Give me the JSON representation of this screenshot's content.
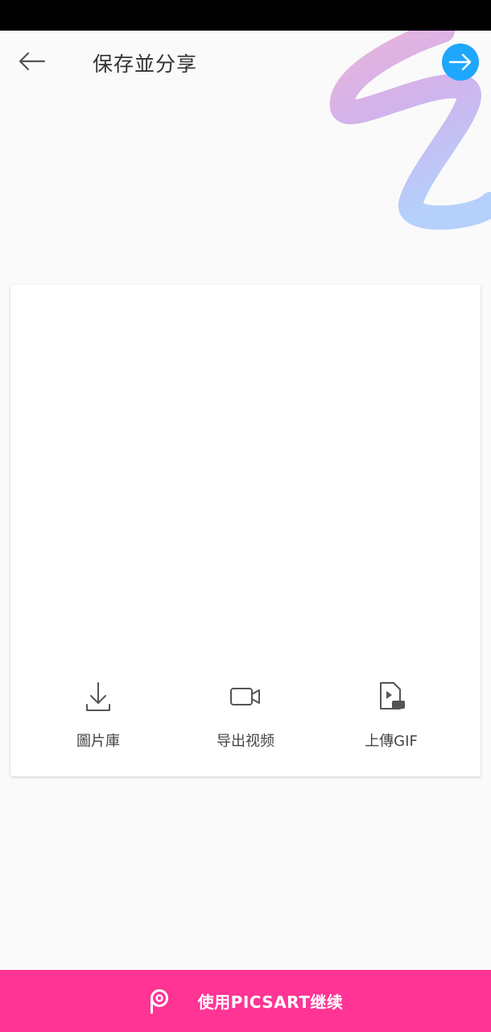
{
  "header": {
    "title": "保存並分享",
    "back_icon": "arrow-left-icon",
    "next_icon": "arrow-right-icon"
  },
  "share_options": [
    {
      "label": "圖片庫",
      "icon": "download-icon"
    },
    {
      "label": "导出视频",
      "icon": "video-camera-icon"
    },
    {
      "label": "上傳GIF",
      "icon": "gif-file-icon"
    }
  ],
  "cta": {
    "label": "使用PICSART继续",
    "icon": "picsart-logo-icon"
  },
  "colors": {
    "accent_blue": "#1ea7fd",
    "cta_pink": "#ff3494",
    "background": "#fafafa"
  }
}
